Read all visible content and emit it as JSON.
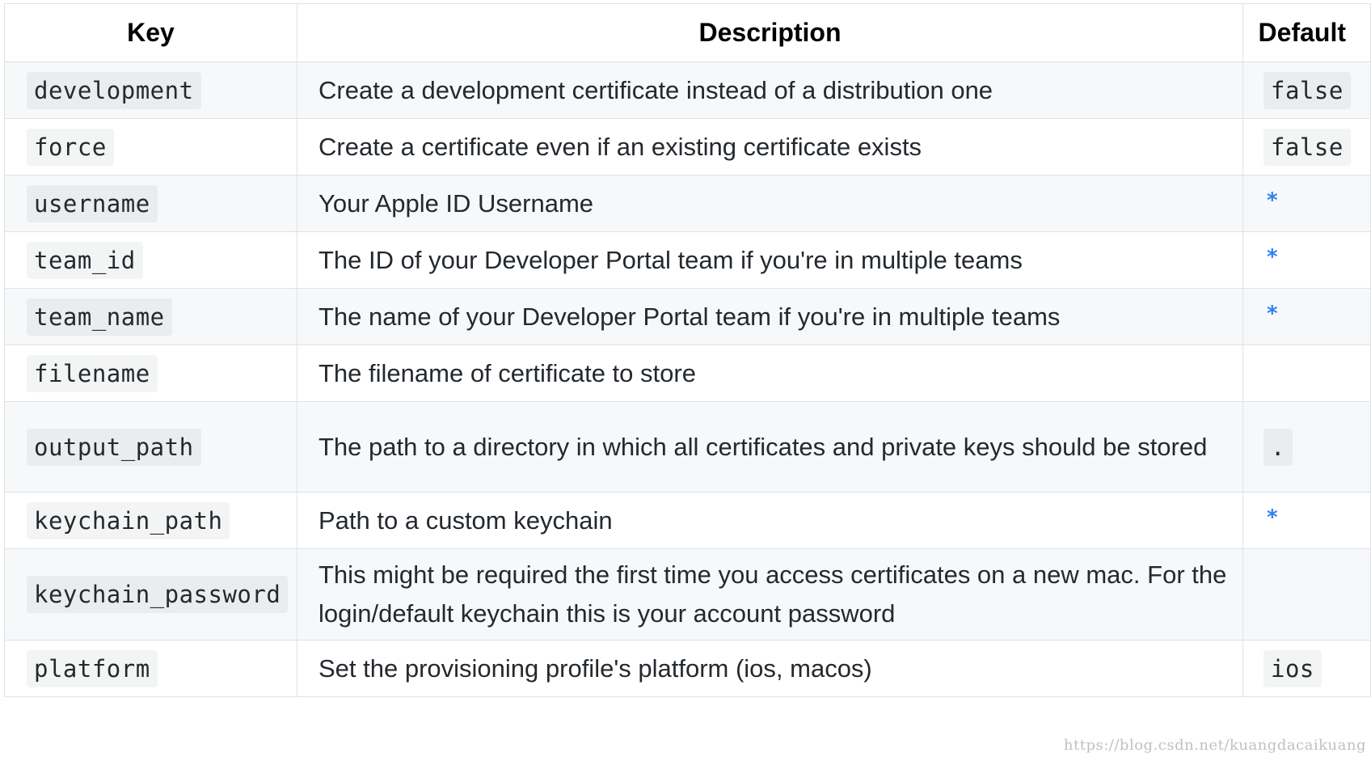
{
  "table": {
    "headers": {
      "key": "Key",
      "description": "Description",
      "default": "Default"
    },
    "rows": [
      {
        "key": "development",
        "description": "Create a development certificate instead of a distribution one",
        "default": "false"
      },
      {
        "key": "force",
        "description": "Create a certificate even if an existing certificate exists",
        "default": "false"
      },
      {
        "key": "username",
        "description": "Your Apple ID Username",
        "default": "*"
      },
      {
        "key": "team_id",
        "description": "The ID of your Developer Portal team if you're in multiple teams",
        "default": "*"
      },
      {
        "key": "team_name",
        "description": "The name of your Developer Portal team if you're in multiple teams",
        "default": "*"
      },
      {
        "key": "filename",
        "description": "The filename of certificate to store",
        "default": ""
      },
      {
        "key": "output_path",
        "description": "The path to a directory in which all certificates and private keys should be stored",
        "default": "."
      },
      {
        "key": "keychain_path",
        "description": "Path to a custom keychain",
        "default": "*"
      },
      {
        "key": "keychain_password",
        "description": "This might be required the first time you access certificates on a new mac. For the login/default keychain this is your account password",
        "default": ""
      },
      {
        "key": "platform",
        "description": "Set the provisioning profile's platform (ios, macos)",
        "default": "ios"
      }
    ]
  },
  "colors": {
    "asterisk": "#2f80ed",
    "border": "#dfe2e5",
    "stripe": "#f6f8fa"
  },
  "watermark": "https://blog.csdn.net/kuangdacaikuang"
}
